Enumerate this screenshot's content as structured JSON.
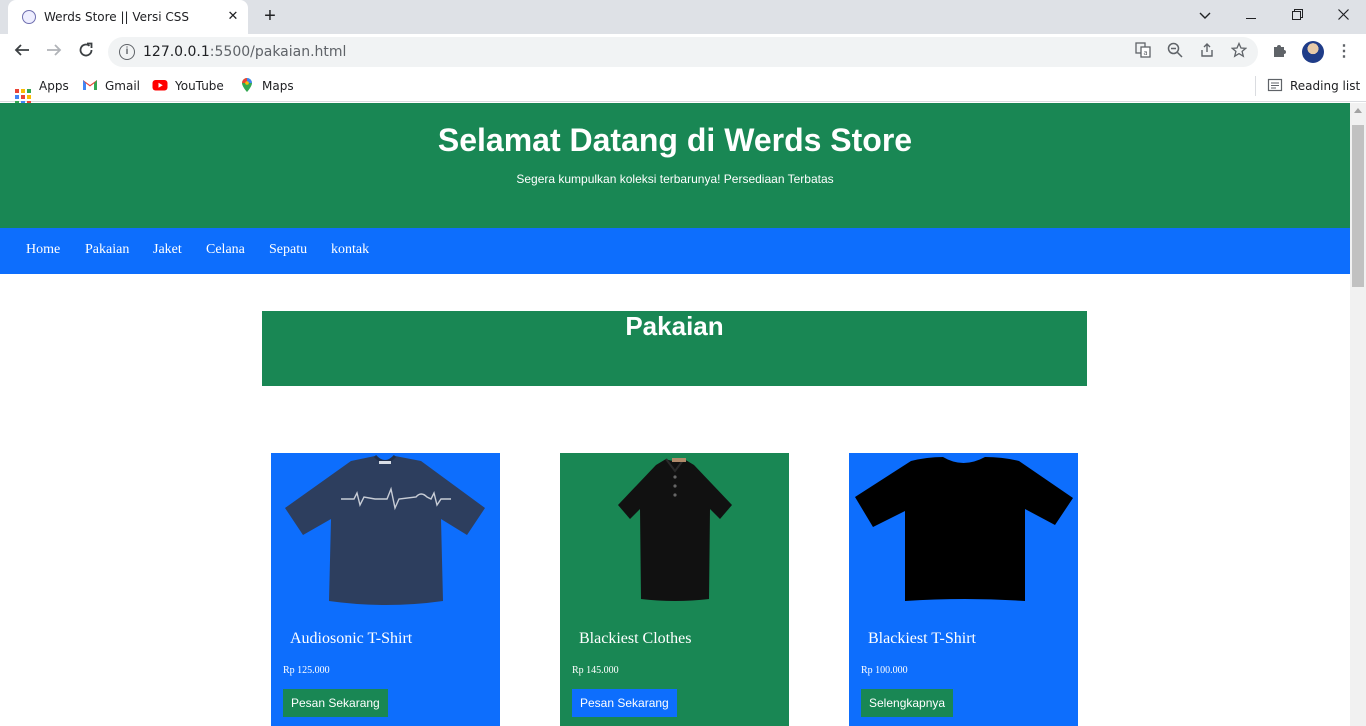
{
  "browser": {
    "tab_title": "Werds Store || Versi CSS",
    "tab_close": "✕",
    "new_tab": "+",
    "url_host": "127.0.0.1",
    "url_rest": ":5500/pakaian.html",
    "bookmarks": [
      {
        "label": "Apps",
        "icon": "apps-grid-icon"
      },
      {
        "label": "Gmail",
        "icon": "gmail-icon"
      },
      {
        "label": "YouTube",
        "icon": "youtube-icon"
      },
      {
        "label": "Maps",
        "icon": "maps-icon"
      }
    ],
    "reading_list": "Reading list"
  },
  "hero": {
    "title": "Selamat Datang di Werds Store",
    "subtitle": "Segera kumpulkan koleksi terbarunya! Persediaan Terbatas"
  },
  "nav": {
    "items": [
      "Home",
      "Pakaian",
      "Jaket",
      "Celana",
      "Sepatu",
      "kontak"
    ]
  },
  "section": {
    "title": "Pakaian"
  },
  "products": [
    {
      "name": "Audiosonic T-Shirt",
      "price": "Rp 125.000",
      "button": "Pesan Sekarang",
      "card_color": "#0d6efd",
      "button_color": "#198754"
    },
    {
      "name": "Blackiest Clothes",
      "price": "Rp 145.000",
      "button": "Pesan Sekarang",
      "card_color": "#198754",
      "button_color": "#0d6efd"
    },
    {
      "name": "Blackiest T-Shirt",
      "price": "Rp 100.000",
      "button": "Selengkapnya",
      "card_color": "#0d6efd",
      "button_color": "#198754"
    }
  ],
  "colors": {
    "green": "#198754",
    "blue": "#0d6efd"
  }
}
